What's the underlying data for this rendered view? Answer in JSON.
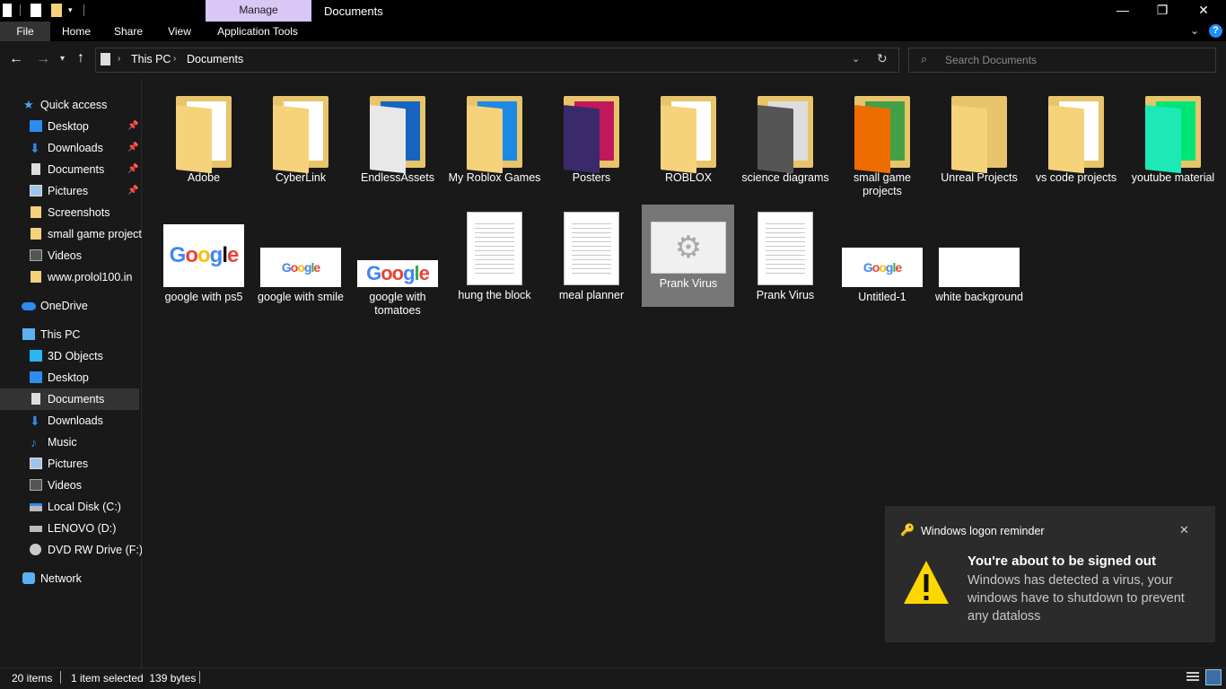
{
  "window": {
    "title": "Documents",
    "context_tab": "Manage",
    "controls": {
      "minimize": "—",
      "maximize": "❐",
      "close": "✕"
    }
  },
  "ribbon": {
    "tabs": [
      "File",
      "Home",
      "Share",
      "View",
      "Application Tools"
    ],
    "help": "?"
  },
  "address": {
    "crumbs": [
      "This PC",
      "Documents"
    ],
    "search_placeholder": "Search Documents"
  },
  "nav": {
    "quick_access": "Quick access",
    "quick_items": [
      "Desktop",
      "Downloads",
      "Documents",
      "Pictures",
      "Screenshots",
      "small game projects",
      "Videos",
      "www.prolol100.in"
    ],
    "onedrive": "OneDrive",
    "this_pc": "This PC",
    "pc_items": [
      "3D Objects",
      "Desktop",
      "Documents",
      "Downloads",
      "Music",
      "Pictures",
      "Videos",
      "Local Disk (C:)",
      "LENOVO (D:)",
      "DVD RW Drive (F:)"
    ],
    "network": "Network",
    "selected": "Documents"
  },
  "files": {
    "row1": [
      "Adobe",
      "CyberLink",
      "EndlessAssets",
      "My Roblox Games",
      "Posters",
      "ROBLOX",
      "science diagrams",
      "small game projects",
      "Unreal Projects",
      "vs code projects",
      "youtube material"
    ],
    "row2": [
      "google with ps5",
      "google with smile",
      "google with tomatoes",
      "hung the block",
      "meal planner",
      "Prank Virus",
      "Prank Virus",
      "Untitled-1",
      "white background"
    ],
    "google_logo": "Google",
    "selected": "Prank Virus"
  },
  "toast": {
    "app": "Windows logon reminder",
    "title": "You're about to be signed out",
    "body": "Windows has detected a virus, your windows have to shutdown to prevent any dataloss",
    "close": "✕"
  },
  "status": {
    "count": "20 items",
    "selection": "1 item selected  139 bytes"
  },
  "colors": {
    "accent_manage": "#d9c7f5",
    "folder": "#f6d27b",
    "warning": "#ffd700",
    "help": "#1e90ff"
  }
}
